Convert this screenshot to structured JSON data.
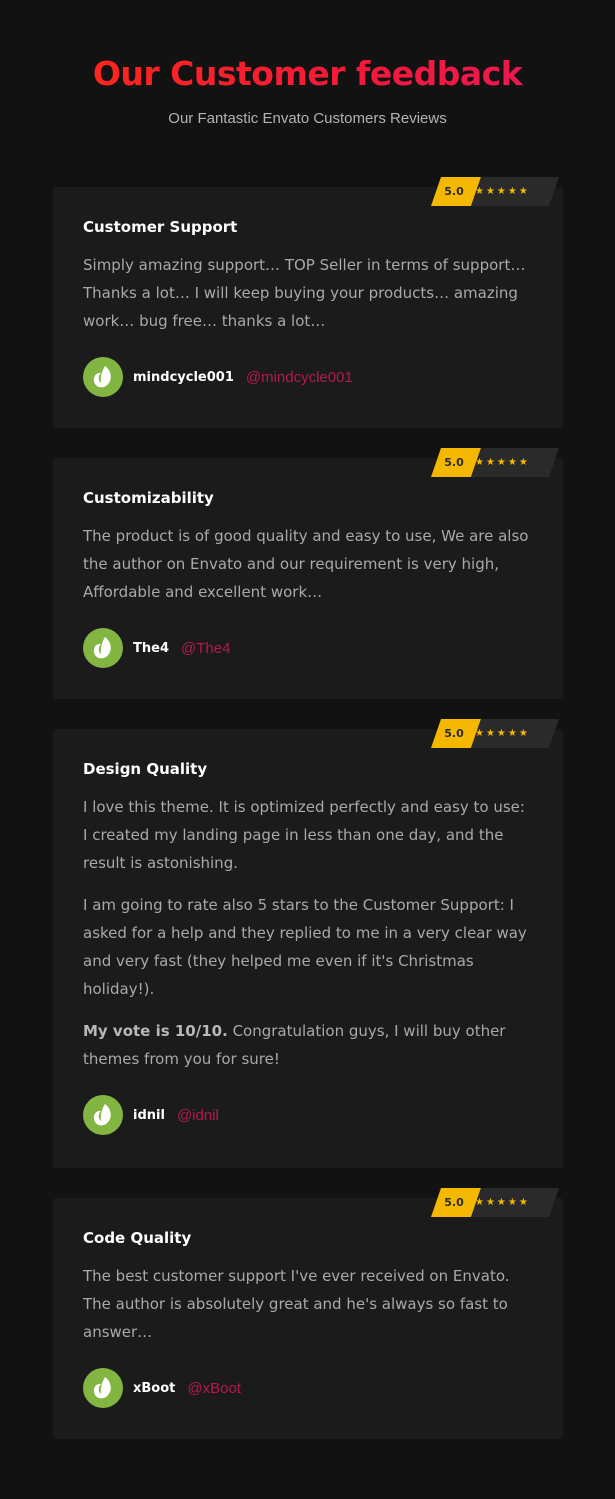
{
  "header": {
    "title": "Our Customer feedback",
    "subtitle": "Our Fantastic Envato Customers Reviews"
  },
  "colors": {
    "background": "#121212",
    "card": "#1b1b1b",
    "accent_star": "#f5b800",
    "handle": "#b7194c",
    "avatar": "#82b541"
  },
  "reviews": [
    {
      "rating": "5.0",
      "stars": "★★★★★",
      "title": "Customer Support",
      "paragraphs": [
        "Simply amazing support… TOP Seller in terms of support… Thanks a lot… I will keep buying your products… amazing work… bug free… thanks a lot…"
      ],
      "username": "mindcycle001",
      "handle": "@mindcycle001",
      "avatar_icon": "envato-leaf-icon"
    },
    {
      "rating": "5.0",
      "stars": "★★★★★",
      "title": "Customizability",
      "paragraphs": [
        "The product is of good quality and easy to use, We are also the author on Envato and our requirement is very high, Affordable and excellent work…"
      ],
      "username": "The4",
      "handle": "@The4",
      "avatar_icon": "envato-leaf-icon"
    },
    {
      "rating": "5.0",
      "stars": "★★★★★",
      "title": "Design Quality",
      "paragraphs": [
        "I love this theme. It is optimized perfectly and easy to use: I created my landing page in less than one day, and the result is astonishing.",
        "I am going to rate also 5 stars to the Customer Support: I asked for a help and they replied to me in a very clear way and very fast (they helped me even if it's Christmas holiday!)."
      ],
      "bold_lead": "My vote is 10/10.",
      "closing": " Congratulation guys, I will buy other themes from you for sure!",
      "username": "idnil",
      "handle": "@idnil",
      "avatar_icon": "envato-leaf-icon"
    },
    {
      "rating": "5.0",
      "stars": "★★★★★",
      "title": "Code Quality",
      "paragraphs": [
        "The best customer support I've ever received on Envato. The author is absolutely great and he's always so fast to answer…"
      ],
      "username": "xBoot",
      "handle": "@xBoot",
      "avatar_icon": "envato-leaf-icon"
    }
  ]
}
